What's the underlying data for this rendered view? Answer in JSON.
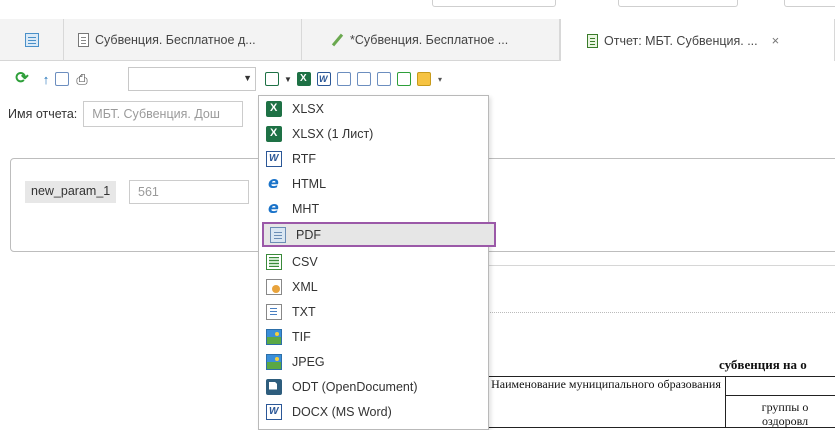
{
  "tabs": [
    {
      "label": "",
      "icon": "grid-icon"
    },
    {
      "label": "Субвенция. Бесплатное д...",
      "icon": "document-icon"
    },
    {
      "label": "*Субвенция. Бесплатное ...",
      "icon": "pencil-icon"
    },
    {
      "label": "Отчет: МБТ. Субвенция. ...",
      "icon": "report-icon",
      "close": "×"
    }
  ],
  "toolbar": {
    "icons": [
      "refresh-icon",
      "arrow-up-icon",
      "copy-icon",
      "print-icon",
      "export-icon",
      "excel-icon",
      "word-icon",
      "export-page-icon",
      "export-pages-icon",
      "image-export-icon",
      "settings-icon",
      "book-icon"
    ],
    "select_value": ""
  },
  "report": {
    "name_label": "Имя отчета:",
    "name_value": "МБТ. Субвенция. Дош"
  },
  "params": {
    "label": "new_param_1",
    "value": "561"
  },
  "report_preview": {
    "heading": "субвенция на о",
    "col1_header": "Наименование муниципального образования",
    "col2_header": "группы о оздоровл"
  },
  "export_menu": {
    "items": [
      {
        "label": "XLSX",
        "icon": "xlsx-icon"
      },
      {
        "label": "XLSX (1 Лист)",
        "icon": "xlsx-icon"
      },
      {
        "label": "RTF",
        "icon": "rtf-icon"
      },
      {
        "label": "HTML",
        "icon": "ie-icon"
      },
      {
        "label": "MHT",
        "icon": "ie-icon"
      },
      {
        "label": "PDF",
        "icon": "pdf-icon",
        "highlighted": true
      },
      {
        "label": "CSV",
        "icon": "csv-icon"
      },
      {
        "label": "XML",
        "icon": "xml-icon"
      },
      {
        "label": "TXT",
        "icon": "txt-icon"
      },
      {
        "label": "TIF",
        "icon": "image-icon"
      },
      {
        "label": "JPEG",
        "icon": "image-icon"
      },
      {
        "label": "ODT (OpenDocument)",
        "icon": "odt-icon"
      },
      {
        "label": "DOCX (MS Word)",
        "icon": "docx-icon"
      }
    ]
  },
  "colors": {
    "highlight_border": "#9b59a8",
    "highlight_bg": "#e6e6e6",
    "tab_bar_bg": "#f3f3f3"
  }
}
